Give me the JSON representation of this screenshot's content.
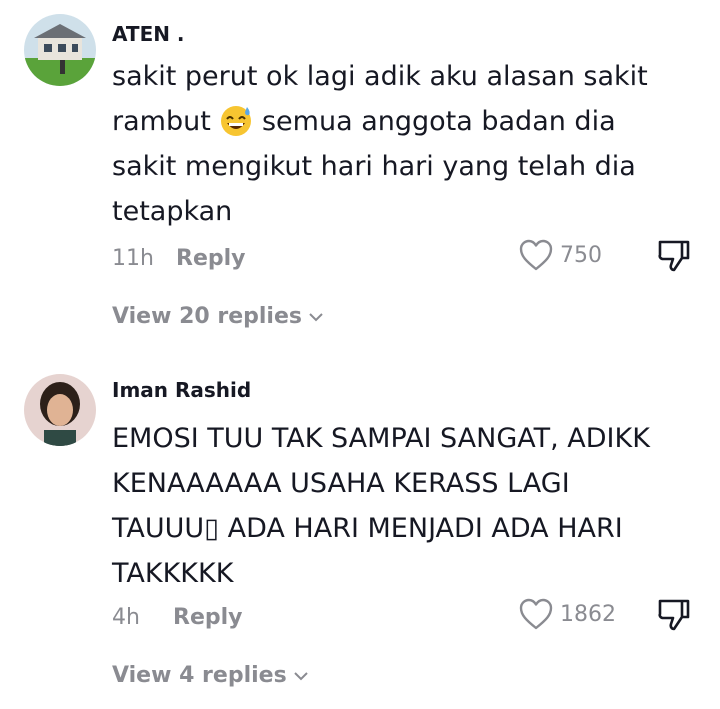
{
  "comments": [
    {
      "username": "ATEN .",
      "text_lines": [
        "sakit perut ok lagi adik aku alasan sakit",
        "rambut",
        "semua anggota badan dia",
        "sakit mengikut hari hari yang telah dia",
        "tetapkan"
      ],
      "emoji": "grinning-sweat-emoji",
      "time": "11h",
      "reply_label": "Reply",
      "like_count": "750",
      "view_replies": "View 20 replies"
    },
    {
      "username": "Iman Rashid",
      "text_lines": [
        "EMOSI TUU TAK SAMPAI SANGAT, ADIKK",
        "KENAAAAAA USAHA KERASS LAGI",
        "TAUUU▯ ADA HARI MENJADI ADA HARI",
        "TAKKKKK"
      ],
      "time": "4h",
      "reply_label": "Reply",
      "like_count": "1862",
      "view_replies": "View 4 replies"
    }
  ],
  "icons": {
    "like": "heart-outline-icon",
    "dislike": "thumbs-down-icon",
    "chevron": "chevron-down-icon"
  },
  "colors": {
    "text": "#161823",
    "muted": "#8a8b91"
  }
}
